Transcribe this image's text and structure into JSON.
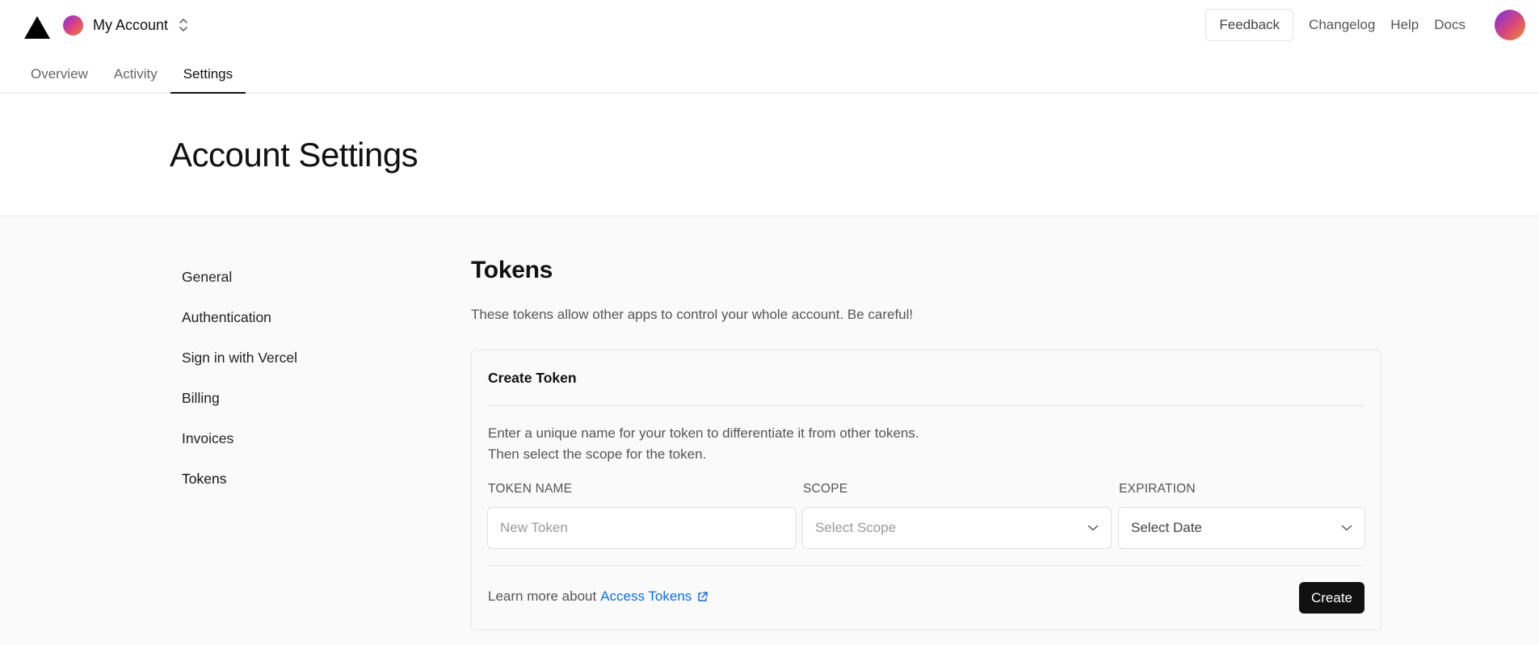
{
  "header": {
    "account_name": "My Account",
    "feedback_label": "Feedback",
    "links": [
      "Changelog",
      "Help",
      "Docs"
    ]
  },
  "tabs": [
    {
      "label": "Overview",
      "active": false
    },
    {
      "label": "Activity",
      "active": false
    },
    {
      "label": "Settings",
      "active": true
    }
  ],
  "page": {
    "title": "Account Settings"
  },
  "sidebar": {
    "items": [
      {
        "label": "General",
        "active": false
      },
      {
        "label": "Authentication",
        "active": false
      },
      {
        "label": "Sign in with Vercel",
        "active": false
      },
      {
        "label": "Billing",
        "active": false
      },
      {
        "label": "Invoices",
        "active": false
      },
      {
        "label": "Tokens",
        "active": true
      }
    ]
  },
  "tokens": {
    "title": "Tokens",
    "description": "These tokens allow other apps to control your whole account. Be careful!",
    "card": {
      "title": "Create Token",
      "desc_line1": "Enter a unique name for your token to differentiate it from other tokens.",
      "desc_line2": "Then select the scope for the token.",
      "fields": {
        "name_label": "TOKEN NAME",
        "name_placeholder": "New Token",
        "name_value": "",
        "scope_label": "SCOPE",
        "scope_placeholder": "Select Scope",
        "expiration_label": "EXPIRATION",
        "expiration_value": "Select Date"
      },
      "footer_text": "Learn more about",
      "footer_link": "Access Tokens",
      "create_label": "Create"
    }
  },
  "colors": {
    "link": "#0a6fe8",
    "primary_button": "#111111",
    "page_bg": "#fafafa"
  },
  "icons": {
    "logo": "triangle-logo-icon",
    "account_switch": "chevron-up-down-icon",
    "select": "chevron-down-icon",
    "external": "external-link-icon"
  }
}
